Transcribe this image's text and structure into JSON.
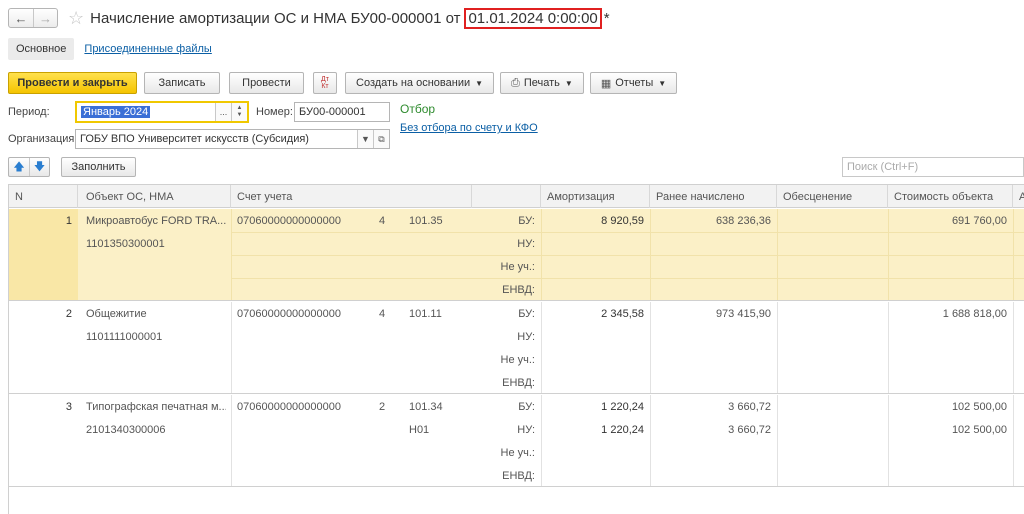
{
  "title": {
    "text": "Начисление амортизации ОС и НМА БУ00-000001 от",
    "date": "01.01.2024 0:00:00",
    "modified": "*"
  },
  "tabs": {
    "main": "Основное",
    "files": "Присоединенные файлы"
  },
  "toolbar": {
    "post_close": "Провести и закрыть",
    "save": "Записать",
    "post": "Провести",
    "dtkt": "Дт Кт",
    "create_based": "Создать на основании",
    "print": "Печать",
    "reports": "Отчеты"
  },
  "form": {
    "period_label": "Период:",
    "period_value": "Январь 2024",
    "number_label": "Номер:",
    "number_value": "БУ00-000001",
    "org_label": "Организация:",
    "org_value": "ГОБУ ВПО Университет искусств (Субсидия)",
    "filter_title": "Отбор",
    "filter_link": "Без отбора по счету и КФО"
  },
  "toolbar2": {
    "fill": "Заполнить",
    "search_placeholder": "Поиск (Ctrl+F)"
  },
  "table": {
    "columns": [
      "N",
      "Объект ОС, НМА",
      "Счет учета",
      "",
      "Амортизация",
      "Ранее начислено",
      "Обесценение",
      "Стоимость объекта",
      "А"
    ],
    "rows": [
      {
        "n": "1",
        "object": "Микроавтобус FORD TRA...",
        "code": "1101350300001",
        "account": "07060000000000000",
        "kfo": "4",
        "subaccount": "101.35",
        "subaccount2": "",
        "labels": [
          "БУ:",
          "НУ:",
          "Не уч.:",
          "ЕНВД:"
        ],
        "amort": [
          "8 920,59",
          "",
          "",
          ""
        ],
        "earlier": [
          "638 236,36",
          "",
          "",
          ""
        ],
        "cost": [
          "691 760,00",
          "",
          "",
          ""
        ]
      },
      {
        "n": "2",
        "object": "Общежитие",
        "code": "1101111000001",
        "account": "07060000000000000",
        "kfo": "4",
        "subaccount": "101.11",
        "subaccount2": "",
        "labels": [
          "БУ:",
          "НУ:",
          "Не уч.:",
          "ЕНВД:"
        ],
        "amort": [
          "2 345,58",
          "",
          "",
          ""
        ],
        "earlier": [
          "973 415,90",
          "",
          "",
          ""
        ],
        "cost": [
          "1 688 818,00",
          "",
          "",
          ""
        ]
      },
      {
        "n": "3",
        "object": "Типографская печатная м...",
        "code": "2101340300006",
        "account": "07060000000000000",
        "kfo": "2",
        "subaccount": "101.34",
        "subaccount2": "Н01",
        "labels": [
          "БУ:",
          "НУ:",
          "Не уч.:",
          "ЕНВД:"
        ],
        "amort": [
          "1 220,24",
          "1 220,24",
          "",
          ""
        ],
        "earlier": [
          "3 660,72",
          "3 660,72",
          "",
          ""
        ],
        "cost": [
          "102 500,00",
          "102 500,00",
          "",
          ""
        ]
      }
    ]
  }
}
